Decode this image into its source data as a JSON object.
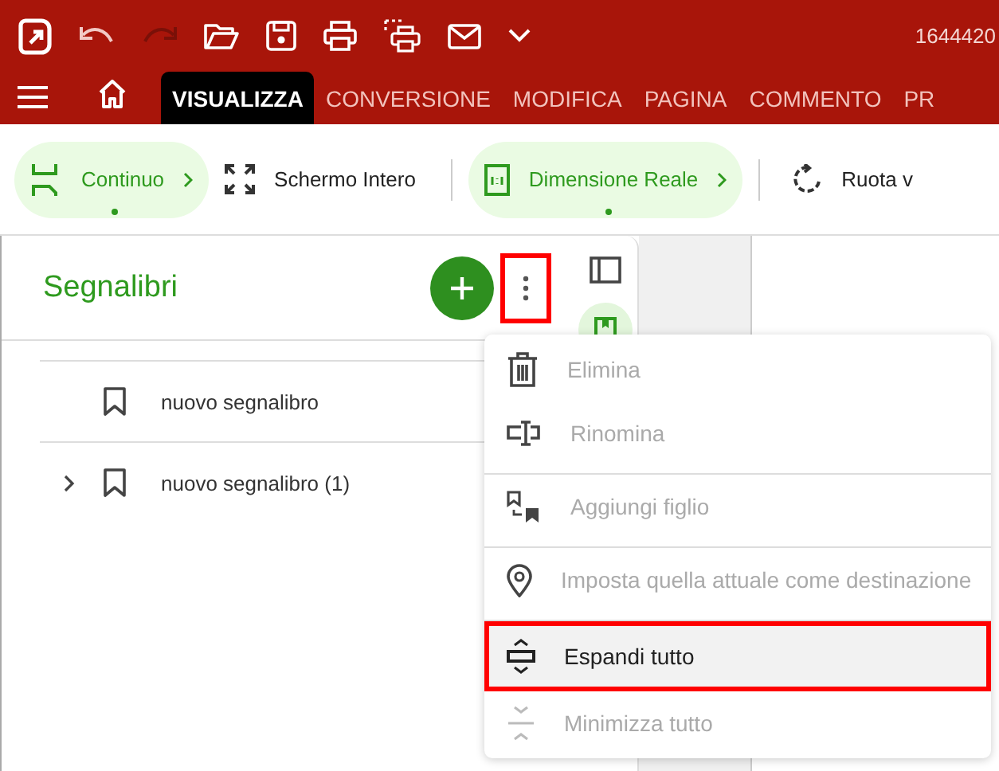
{
  "titlebar": {
    "doc_id": "1644420"
  },
  "tabs": [
    {
      "label": "VISUALIZZA",
      "selected": true
    },
    {
      "label": "CONVERSIONE",
      "selected": false
    },
    {
      "label": "MODIFICA",
      "selected": false
    },
    {
      "label": "PAGINA",
      "selected": false
    },
    {
      "label": "COMMENTO",
      "selected": false
    },
    {
      "label": "PR",
      "selected": false
    }
  ],
  "toolbar": [
    {
      "kind": "continuous",
      "label": "Continuo",
      "active": true,
      "chevron": true,
      "separator_after": false
    },
    {
      "kind": "fullscreen",
      "label": "Schermo Intero",
      "active": false,
      "chevron": false,
      "separator_after": true
    },
    {
      "kind": "actualsize",
      "label": "Dimensione Reale",
      "active": true,
      "chevron": true,
      "separator_after": true
    },
    {
      "kind": "rotate",
      "label": "Ruota v",
      "active": false,
      "chevron": false,
      "separator_after": false
    }
  ],
  "panel": {
    "title": "Segnalibri",
    "more_highlighted": true
  },
  "bookmarks": [
    {
      "label": "nuovo segnalibro",
      "expandable": false
    },
    {
      "label": "nuovo segnalibro (1)",
      "expandable": true
    }
  ],
  "side_strip": [
    {
      "kind": "panel",
      "selected": false
    },
    {
      "kind": "bookmark",
      "selected": true
    }
  ],
  "menu": [
    [
      {
        "kind": "delete",
        "label": "Elimina",
        "disabled": true,
        "highlighted": false
      },
      {
        "kind": "rename",
        "label": "Rinomina",
        "disabled": true,
        "highlighted": false
      }
    ],
    [
      {
        "kind": "addchild",
        "label": "Aggiungi figlio",
        "disabled": true,
        "highlighted": false
      }
    ],
    [
      {
        "kind": "destination",
        "label": "Imposta quella attuale come destinazione",
        "disabled": true,
        "highlighted": false
      }
    ],
    [
      {
        "kind": "expand",
        "label": "Espandi tutto",
        "disabled": false,
        "highlighted": true
      },
      {
        "kind": "collapse",
        "label": "Minimizza tutto",
        "disabled": true,
        "highlighted": false
      }
    ]
  ]
}
